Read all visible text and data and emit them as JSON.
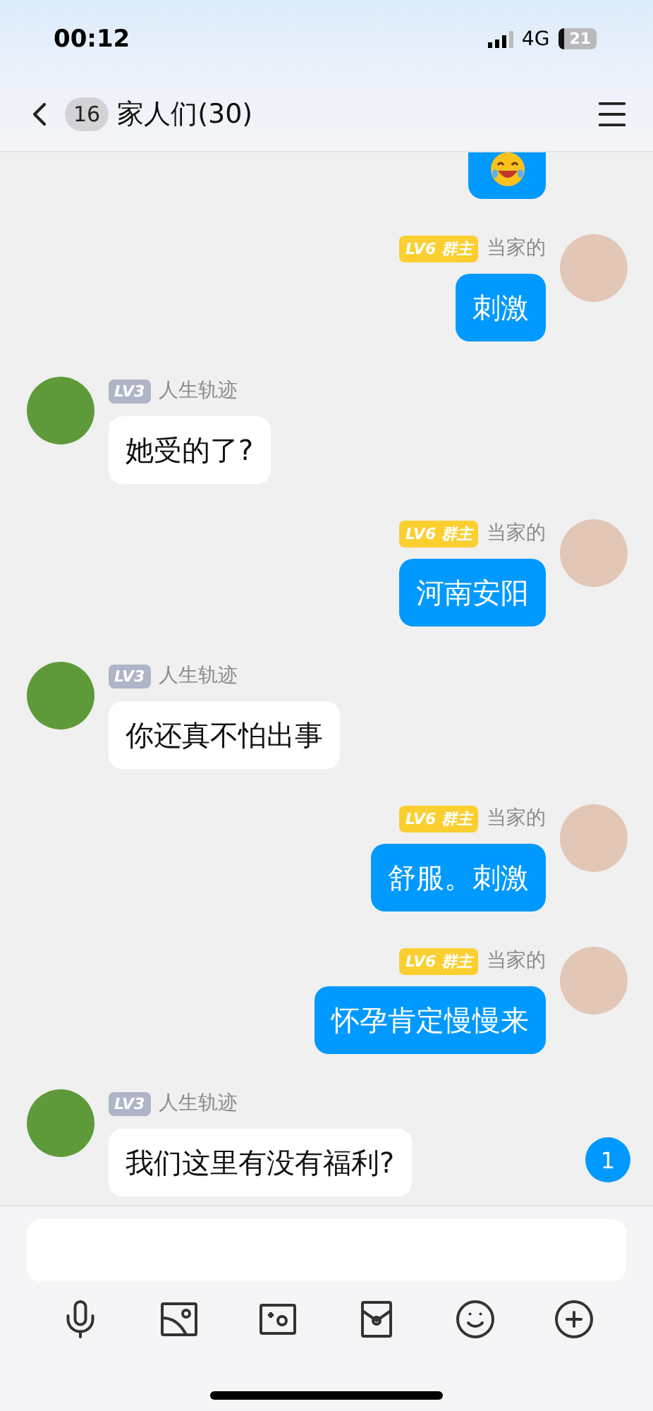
{
  "status_bar": {
    "time": "00:12",
    "network": "4G",
    "battery": "21"
  },
  "header": {
    "unread_count": "16",
    "title": "家人们(30)"
  },
  "messages": [
    {
      "outgoing": true,
      "kind": "sticker"
    },
    {
      "outgoing": true,
      "kind": "text",
      "level": "LV6",
      "role": "群主",
      "name": "当家的",
      "text": "刺激"
    },
    {
      "outgoing": false,
      "kind": "text",
      "level": "LV3",
      "name": "人生轨迹",
      "text": "她受的了?"
    },
    {
      "outgoing": true,
      "kind": "text",
      "level": "LV6",
      "role": "群主",
      "name": "当家的",
      "text": "河南安阳"
    },
    {
      "outgoing": false,
      "kind": "text",
      "level": "LV3",
      "name": "人生轨迹",
      "text": "你还真不怕出事"
    },
    {
      "outgoing": true,
      "kind": "text",
      "level": "LV6",
      "role": "群主",
      "name": "当家的",
      "text": "舒服。刺激"
    },
    {
      "outgoing": true,
      "kind": "text",
      "level": "LV6",
      "role": "群主",
      "name": "当家的",
      "text": "怀孕肯定慢慢来"
    },
    {
      "outgoing": false,
      "kind": "text",
      "level": "LV3",
      "name": "人生轨迹",
      "text": "我们这里有没有福利?"
    }
  ],
  "new_message_badge": "1"
}
